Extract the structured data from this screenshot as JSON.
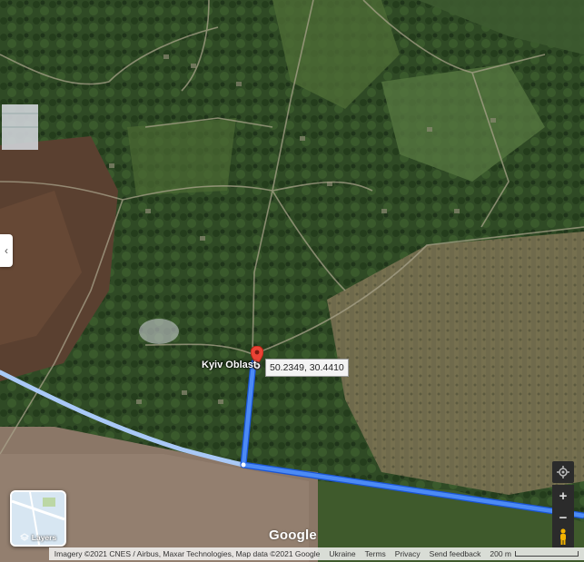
{
  "map": {
    "place_label": "Kyiv Oblast",
    "coordinates": "50.2349, 30.4410",
    "route_color": "#4c8bf5",
    "route_casing_color": "#1a55d6",
    "secondary_route_color": "#a9c9f7"
  },
  "controls": {
    "layers_label": "Layers",
    "zoom_in": "+",
    "zoom_out": "−",
    "collapse_icon": "‹"
  },
  "branding": {
    "logo": "Google"
  },
  "footer": {
    "imagery": "Imagery ©2021 CNES / Airbus, Maxar Technologies, Map data ©2021 Google",
    "country": "Ukraine",
    "terms": "Terms",
    "privacy": "Privacy",
    "feedback": "Send feedback",
    "scale": "200 m"
  }
}
